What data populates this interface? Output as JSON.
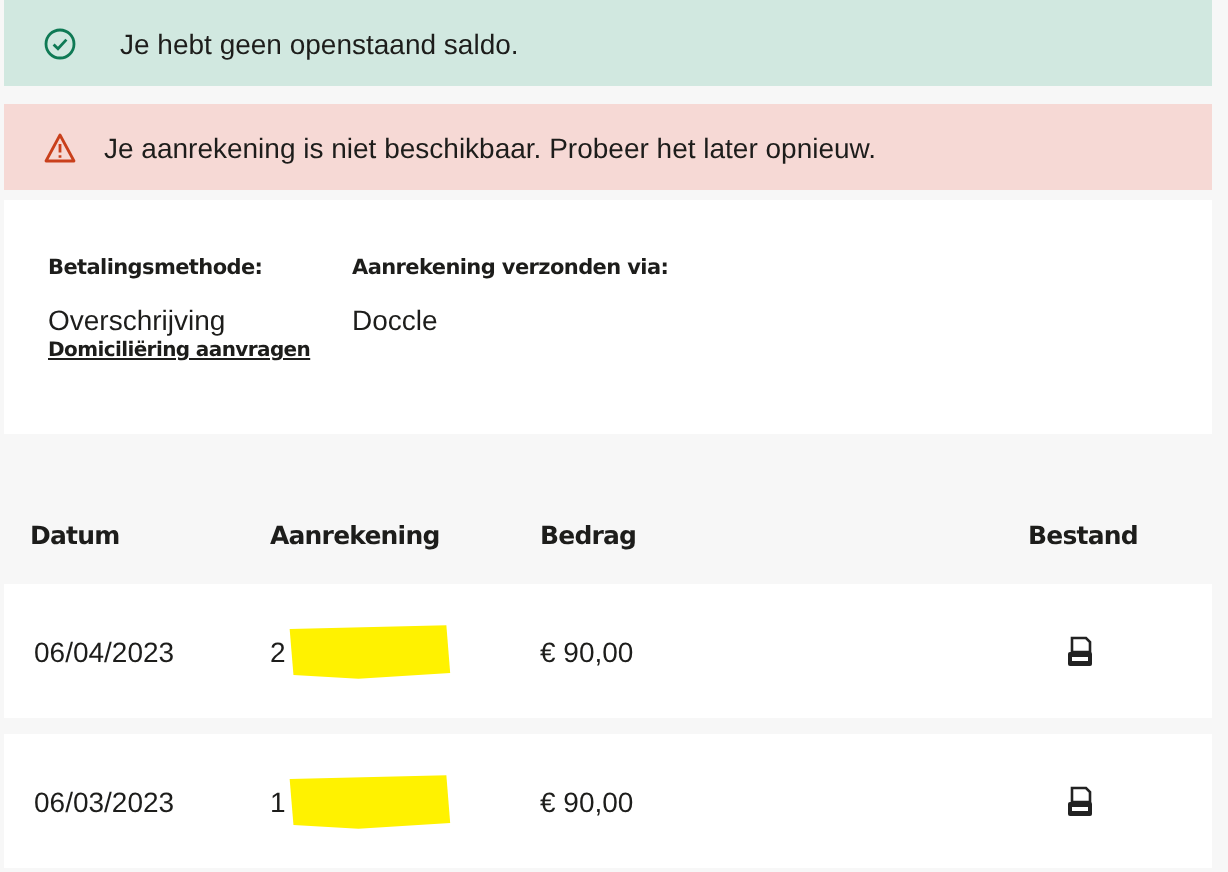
{
  "alerts": [
    {
      "kind": "success",
      "text": "Je hebt geen openstaand saldo."
    },
    {
      "kind": "error",
      "text": "Je aanrekening is niet beschikbaar. Probeer het later opnieuw."
    }
  ],
  "details": {
    "payment_method_label": "Betalingsmethode:",
    "payment_method": "Overschrijving",
    "direct_debit_link": "Domiciliëring aanvragen",
    "sent_via_label": "Aanrekening verzonden via:",
    "sent_via": "Doccle"
  },
  "table": {
    "columns": [
      "Datum",
      "Aanrekening",
      "Bedrag",
      "Bestand"
    ],
    "rows": [
      {
        "date": "06/04/2023",
        "invoice": "2",
        "redacted": true,
        "amount": "€ 90,00"
      },
      {
        "date": "06/03/2023",
        "invoice": "1",
        "redacted": true,
        "amount": "€ 90,00"
      }
    ]
  }
}
